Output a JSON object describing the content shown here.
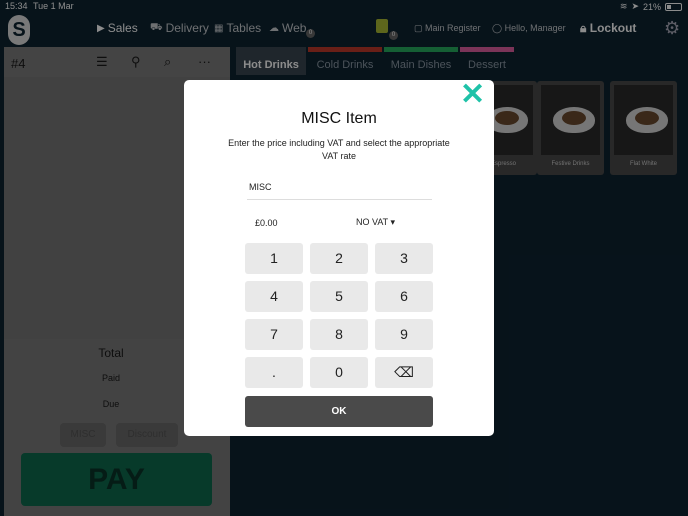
{
  "status_bar": {
    "time": "15:34",
    "date": "Tue 1 Mar",
    "battery": "21%"
  },
  "nav": {
    "logo": "S",
    "sales": "Sales",
    "delivery": "Delivery",
    "tables": "Tables",
    "web": "Web",
    "web_badge": "0",
    "printer_badge": "0",
    "register": "Main Register",
    "user": "Hello, Manager",
    "lockout": "Lockout"
  },
  "order": {
    "number": "#4",
    "total_label": "Total",
    "paid_label": "Paid",
    "due_label": "Due",
    "misc_label": "MISC",
    "discount_label": "Discount",
    "pay_label": "PAY"
  },
  "categories": [
    {
      "label": "Hot Drinks",
      "color": "#3a4650",
      "active": true
    },
    {
      "label": "Cold Drinks",
      "color": "#c0392b",
      "active": false
    },
    {
      "label": "Main Dishes",
      "color": "#27ae60",
      "active": false
    },
    {
      "label": "Dessert",
      "color": "#e05fa0",
      "active": false
    }
  ],
  "products": [
    {
      "name": "Espresso"
    },
    {
      "name": "Festive Drinks"
    },
    {
      "name": "Flat White"
    }
  ],
  "modal": {
    "title": "MISC Item",
    "description": "Enter the price including VAT and select the appropriate VAT rate",
    "name_value": "MISC",
    "price_value": "£0.00",
    "vat_value": "NO VAT",
    "keys": [
      "1",
      "2",
      "3",
      "4",
      "5",
      "6",
      "7",
      "8",
      "9",
      ".",
      "0",
      "⌫"
    ],
    "ok_label": "OK",
    "close_label": "✕"
  },
  "colors": {
    "accent": "#1fc2a8",
    "pay": "#0d6a4d",
    "background": "#0d2331"
  }
}
